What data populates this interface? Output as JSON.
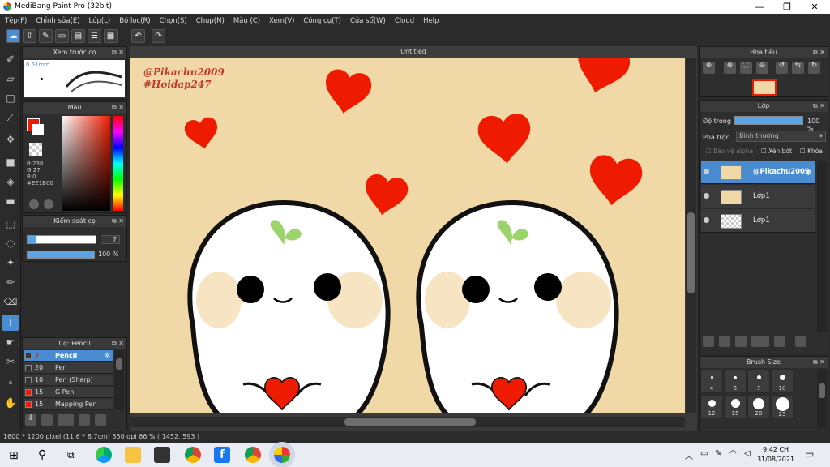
{
  "window": {
    "title": "MediBang Paint Pro (32bit)",
    "controls": [
      "—",
      "❐",
      "✕"
    ]
  },
  "menu": [
    "Tệp(F)",
    "Chỉnh sửa(E)",
    "Lớp(L)",
    "Bộ lọc(R)",
    "Chọn(S)",
    "Chụp(N)",
    "Màu (C)",
    "Xem(V)",
    "Công cụ(T)",
    "Cửa sổ(W)",
    "Cloud",
    "Help"
  ],
  "document": {
    "tab": "Untitled"
  },
  "canvas_text": {
    "line1": "@Pikachu2009",
    "line2": "#Hoidap247"
  },
  "brush_preview": {
    "title": "Xem trước cọ",
    "size": "0.51mm"
  },
  "color_panel": {
    "title": "Màu",
    "r": "R:238",
    "g": "G:27",
    "b": "B:0",
    "hex": "#EE1B00",
    "primary": "#EE1B00",
    "secondary": "#ffffff"
  },
  "brush_control": {
    "title": "Kiểm soát cọ",
    "size": "7",
    "opacity": "100 %"
  },
  "brush_list": {
    "title": "Cọ: Pencil",
    "items": [
      {
        "num": "7",
        "label": "Pencil",
        "color": "#EE1B00",
        "selected": true
      },
      {
        "num": "20",
        "label": "Pen",
        "color": "#333333",
        "selected": false
      },
      {
        "num": "10",
        "label": "Pen (Sharp)",
        "color": "#333333",
        "selected": false
      },
      {
        "num": "15",
        "label": "G Pen",
        "color": "#EE1B00",
        "selected": false
      },
      {
        "num": "15",
        "label": "Mapping Pen",
        "color": "#EE1B00",
        "selected": false
      }
    ]
  },
  "navigator": {
    "title": "Hoa tiêu"
  },
  "layer_panel": {
    "title": "Lớp",
    "opacity_label": "Độ trong",
    "opacity_value": "100 %",
    "blend_label": "Pha trộn",
    "blend_value": "Bình thường",
    "protect_alpha": "Bảo vệ alpha",
    "clip": "Xén bớt",
    "lock": "Khóa",
    "layers": [
      {
        "name": "@Pikachu2009",
        "selected": true
      },
      {
        "name": "Lớp1",
        "selected": false
      },
      {
        "name": "Lớp1",
        "selected": false
      }
    ]
  },
  "brush_size": {
    "title": "Brush Size",
    "sizes": [
      "4",
      "5",
      "7",
      "10",
      "12",
      "15",
      "20",
      "25"
    ]
  },
  "status": {
    "text": "1600 * 1200 pixel  (11.6 * 8.7cm)  350 dpi  66 %  ( 1452, 593 )"
  },
  "taskbar": {
    "time": "9:42 CH",
    "date": "31/08/2021"
  }
}
